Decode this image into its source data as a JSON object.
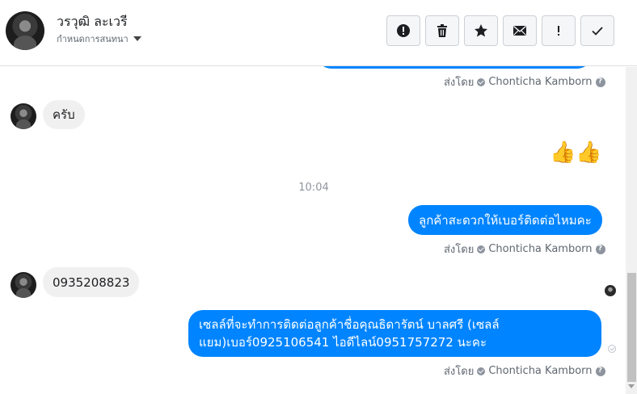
{
  "header": {
    "contact_name": "วรวุฒิ ละเวรี",
    "assign_label": "กำหนดการสนทนา",
    "actions": [
      {
        "name": "spam-icon"
      },
      {
        "name": "trash-icon"
      },
      {
        "name": "star-icon"
      },
      {
        "name": "mail-icon"
      },
      {
        "name": "important-icon"
      },
      {
        "name": "check-icon"
      }
    ]
  },
  "messages": {
    "sent_by_prefix": "ส่งโดย",
    "agent_name": "Chonticha Kamborn",
    "help_glyph": "?",
    "in_1": "ครับ",
    "emoji_out": "👍👍",
    "timestamp": "10:04",
    "out_1": "ลูกค้าสะดวกให้เบอร์ติดต่อไหมคะ",
    "in_2": "0935208823",
    "out_2_line1": "เซลล์ที่จะทำการติดต่อลูกค้าชื่อคุณธิดารัตน์ บาลศรี (เซลล์",
    "out_2_line2": "แยม)เบอร์0925106541 ไอดีไลน์0951757272 นะคะ"
  },
  "colors": {
    "outgoing_bubble": "#0084ff",
    "incoming_bubble": "#f1f0f0",
    "meta_text": "#606770"
  }
}
